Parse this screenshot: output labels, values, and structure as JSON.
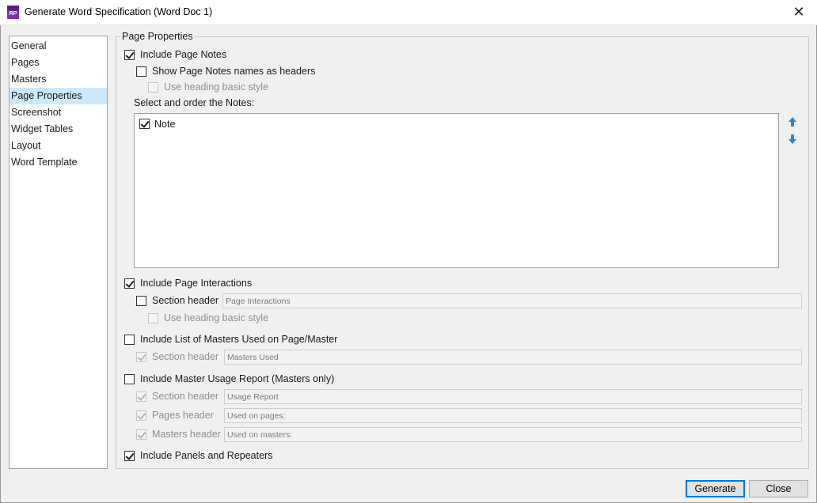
{
  "window": {
    "title": "Generate Word Specification (Word Doc 1)",
    "app_icon_text": "RP",
    "close_symbol": "✕"
  },
  "nav": {
    "items": [
      {
        "label": "General"
      },
      {
        "label": "Pages"
      },
      {
        "label": "Masters"
      },
      {
        "label": "Page Properties"
      },
      {
        "label": "Screenshot"
      },
      {
        "label": "Widget Tables"
      },
      {
        "label": "Layout"
      },
      {
        "label": "Word Template"
      }
    ],
    "selected": "Page Properties"
  },
  "page_properties": {
    "group_title": "Page Properties",
    "include_page_notes": {
      "label": "Include Page Notes",
      "checked": true
    },
    "show_notes_as_headers": {
      "label": "Show Page Notes names as headers",
      "checked": false
    },
    "notes_heading_style": {
      "label": "Use heading basic style",
      "checked": false,
      "enabled": false
    },
    "notes_order_label": "Select and order the Notes:",
    "notes_list": [
      {
        "label": "Note",
        "checked": true
      }
    ],
    "move_up_icon": "arrow-up",
    "move_down_icon": "arrow-down",
    "include_interactions": {
      "label": "Include Page Interactions",
      "checked": true
    },
    "interactions_section_header": {
      "label": "Section header",
      "checked": false,
      "value": "Page Interactions"
    },
    "interactions_heading_style": {
      "label": "Use heading basic style",
      "checked": false,
      "enabled": false
    },
    "include_masters_list": {
      "label": "Include List of Masters Used on Page/Master",
      "checked": false
    },
    "masters_section_header": {
      "label": "Section header",
      "checked": true,
      "enabled": false,
      "value": "Masters Used"
    },
    "include_master_usage": {
      "label": "Include Master Usage Report (Masters only)",
      "checked": false
    },
    "usage_section_header": {
      "label": "Section header",
      "checked": true,
      "enabled": false,
      "value": "Usage Report"
    },
    "usage_pages_header": {
      "label": "Pages header",
      "checked": true,
      "enabled": false,
      "value": "Used on pages:"
    },
    "usage_masters_header": {
      "label": "Masters header",
      "checked": true,
      "enabled": false,
      "value": "Used on masters:"
    },
    "include_panels": {
      "label": "Include Panels and Repeaters",
      "checked": true
    }
  },
  "footer": {
    "generate_label": "Generate",
    "close_label": "Close"
  },
  "colors": {
    "selection": "#cce8ff",
    "accent": "#0078d7",
    "arrow": "#1f8ad8",
    "app_icon": "#7b2fa8"
  }
}
